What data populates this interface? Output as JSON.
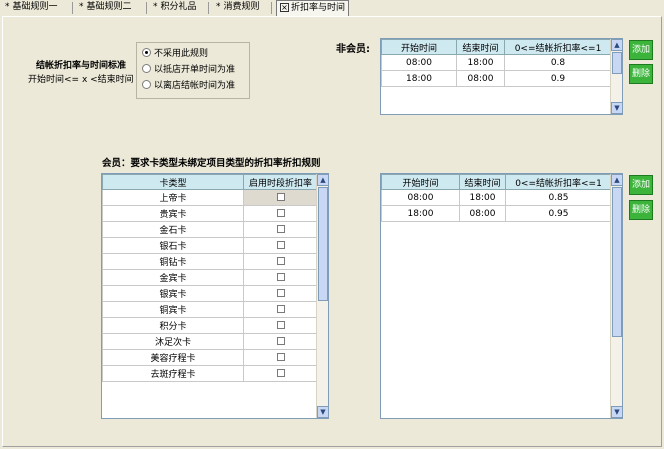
{
  "tabs": [
    {
      "label": "基础规则一",
      "active": false
    },
    {
      "label": "基础规则二",
      "active": false
    },
    {
      "label": "积分礼品",
      "active": false
    },
    {
      "label": "消费规则",
      "active": false
    },
    {
      "label": "折扣率与时间",
      "active": true
    }
  ],
  "left_title": "结帐折扣率与时间标准",
  "left_subtitle": "开始时间<= x <结束时间",
  "radio_options": [
    {
      "label": "不采用此规则",
      "selected": true
    },
    {
      "label": "以抵店开单时间为准",
      "selected": false
    },
    {
      "label": "以离店结帐时间为准",
      "selected": false
    }
  ],
  "nonmember": {
    "label": "非会员:",
    "columns": [
      "开始时间",
      "结束时间",
      "0<=结帐折扣率<=1"
    ],
    "rows": [
      [
        "08:00",
        "18:00",
        "0.8"
      ],
      [
        "18:00",
        "08:00",
        "0.9"
      ]
    ],
    "add_label": "添加",
    "delete_label": "删除"
  },
  "member": {
    "label": "会员：要求卡类型未绑定项目类型的折扣率折扣规则",
    "card_columns": [
      "卡类型",
      "启用时段折扣率"
    ],
    "card_rows": [
      "上帝卡",
      "贵宾卡",
      "金石卡",
      "银石卡",
      "铜钻卡",
      "金宾卡",
      "银宾卡",
      "铜宾卡",
      "积分卡",
      "沐足次卡",
      "美容疗程卡",
      "去斑疗程卡"
    ],
    "rate_columns": [
      "开始时间",
      "结束时间",
      "0<=结帐折扣率<=1"
    ],
    "rate_rows": [
      [
        "08:00",
        "18:00",
        "0.85"
      ],
      [
        "18:00",
        "08:00",
        "0.95"
      ]
    ],
    "add_label": "添加",
    "delete_label": "删除"
  },
  "icons": {
    "scroll_up": "▲",
    "scroll_down": "▼"
  }
}
